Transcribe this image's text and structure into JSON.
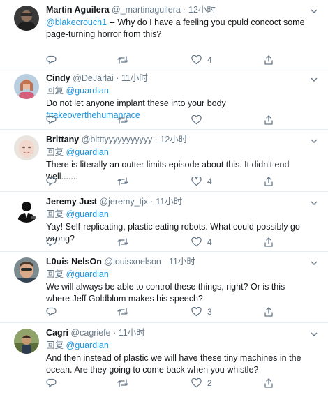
{
  "tweets": [
    {
      "name": "Martin Aguilera",
      "handle": "@_martinaguilera",
      "time": "12小时",
      "reply_prefix": "",
      "reply_to": "",
      "text_mention": "@blakecrouch1",
      "text": " -- Why do I have a feeling you cpuld concoct some page-turning horror from this?",
      "text_hashtag": "",
      "reply_count": "",
      "retweet_count": "",
      "like_count": "4"
    },
    {
      "name": "Cindy",
      "handle": "@DeJarlai",
      "time": "11小时",
      "reply_prefix": "回复",
      "reply_to": "@guardian",
      "text_mention": "",
      "text": "Do not let anyone implant these into your body ",
      "text_hashtag": "#takeoverthehumanrace",
      "reply_count": "",
      "retweet_count": "",
      "like_count": ""
    },
    {
      "name": "Brittany",
      "handle": "@bitttyyyyyyyyyyy",
      "time": "12小时",
      "reply_prefix": "回复",
      "reply_to": "@guardian",
      "text_mention": "",
      "text": "There is literally an outter limits episode about this. It didn't end well.......",
      "text_hashtag": "",
      "reply_count": "",
      "retweet_count": "",
      "like_count": "4"
    },
    {
      "name": "Jeremy Just",
      "handle": "@jeremy_tjx",
      "time": "11小时",
      "reply_prefix": "回复",
      "reply_to": "@guardian",
      "text_mention": "",
      "text": "Yay! Self-replicating, plastic eating robots. What could possibly go wrong?",
      "text_hashtag": "",
      "reply_count": "",
      "retweet_count": "",
      "like_count": "4"
    },
    {
      "name": "L0uis NelsOn",
      "handle": "@louisxnelson",
      "time": "11小时",
      "reply_prefix": "回复",
      "reply_to": "@guardian",
      "text_mention": "",
      "text": "We will always be able to control these things, right? Or is this where Jeff Goldblum makes his speech?",
      "text_hashtag": "",
      "reply_count": "",
      "retweet_count": "",
      "like_count": "3"
    },
    {
      "name": "Cagri",
      "handle": "@cagriefe",
      "time": "11小时",
      "reply_prefix": "回复",
      "reply_to": "@guardian",
      "text_mention": "",
      "text": "And then instead of plastic we will have these tiny machines in the ocean. Are they going to come back when you whistle?",
      "text_hashtag": "",
      "reply_count": "",
      "retweet_count": "",
      "like_count": "2"
    }
  ],
  "separator": "·",
  "colors": {
    "accent": "#1b95e0",
    "muted": "#657786",
    "divider": "#e6ecf0"
  }
}
